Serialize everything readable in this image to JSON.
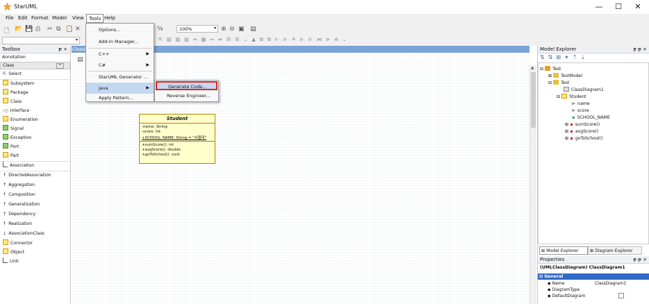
{
  "window": {
    "title": "StarUML",
    "minimize": "—",
    "maximize": "☐",
    "close": "✕"
  },
  "menubar": {
    "items": [
      "File",
      "Edit",
      "Format",
      "Model",
      "View",
      "Tools",
      "Help"
    ]
  },
  "toolbar": {
    "zoom": "100%"
  },
  "toolbox": {
    "title": "Toolbox",
    "pin": "ᵽ ×",
    "section_annotation": "Annotation",
    "section_class": "Class",
    "items": [
      "Select",
      "Subsystem",
      "Package",
      "Class",
      "Interface",
      "Enumeration",
      "Signal",
      "Exception",
      "Port",
      "Part",
      "Association",
      "DirectedAssociation",
      "Aggregation",
      "Composition",
      "Generalization",
      "Dependency",
      "Realization",
      "AssociationClass",
      "Connector",
      "Object",
      "Link"
    ]
  },
  "diagram_tab": {
    "label": "ClassD"
  },
  "tools_menu": {
    "items": [
      "Options...",
      "Add-In Manager...",
      "C++",
      "C#",
      "StarUML Generator ...",
      "Java",
      "Apply Pattern..."
    ]
  },
  "java_submenu": {
    "items": [
      "Generate Code...",
      "Reverse Engineer..."
    ]
  },
  "class_student": {
    "name": "Student",
    "attributes": [
      "-name: String",
      "-score: Int",
      "+SCHOOL_NAME: String = \"서울대\""
    ],
    "operations": [
      "+sumScore(): int",
      "+avgScore(): double",
      "+goToSchool(): void"
    ]
  },
  "model_explorer": {
    "title": "Model Explorer",
    "pin": "ᵽ ᵽ ×",
    "tree": [
      {
        "label": "Test",
        "level": 0
      },
      {
        "label": "TestModel",
        "level": 1
      },
      {
        "label": "Test",
        "level": 1
      },
      {
        "label": "ClassDiagram1",
        "level": 2
      },
      {
        "label": "Student",
        "level": 2
      },
      {
        "label": "name",
        "level": 3
      },
      {
        "label": "score",
        "level": 3
      },
      {
        "label": "SCHOOL_NAME",
        "level": 3
      },
      {
        "label": "sumScore()",
        "level": 3
      },
      {
        "label": "avgScore()",
        "level": 3
      },
      {
        "label": "goToSchool()",
        "level": 3
      }
    ],
    "tabs": [
      "Model Explorer",
      "Diagram Explorer"
    ]
  },
  "properties": {
    "title": "Properties",
    "pin": "ᵽ ᵽ ×",
    "header": "(UMLClassDiagram) ClassDiagram1",
    "group": "General",
    "rows": [
      {
        "key": "Name",
        "value": "ClassDiagram1"
      },
      {
        "key": "DiagramType",
        "value": ""
      },
      {
        "key": "DefaultDiagram",
        "value": ""
      }
    ]
  },
  "colors": {
    "accent": "#316ac5",
    "selection_border": "#e02020"
  }
}
